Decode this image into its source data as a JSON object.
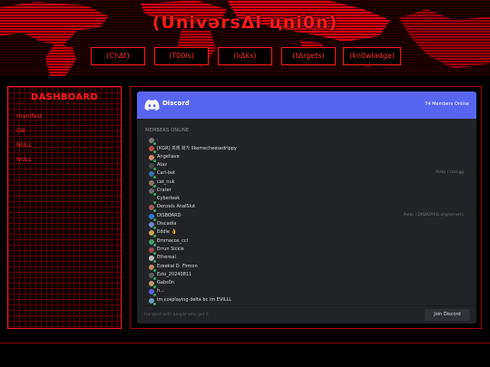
{
  "site": {
    "title": "(UnivǝrsΔl цni0n)"
  },
  "nav": [
    {
      "label": "(ChΔt)"
    },
    {
      "label": "(T00ls)"
    },
    {
      "label": "(lıΔks)"
    },
    {
      "label": "(tΔrgets)"
    },
    {
      "label": "(kn0wlədge)"
    }
  ],
  "sidebar": {
    "heading": "DASHBOARD",
    "items": [
      {
        "label": "manifest"
      },
      {
        "label": "DB"
      },
      {
        "label": "NULL"
      },
      {
        "label": "NULL"
      }
    ]
  },
  "discord": {
    "brand": "Discord",
    "online": "74 Members Online",
    "section": "MEMBERS ONLINE",
    "footer_text": "Hangout with people who get it",
    "join_label": "Join Discord",
    "members": [
      {
        "name": ".",
        "game": "",
        "avatar_color": "#7a7a7a"
      },
      {
        "name": "[KGR] 피래 화가 likemecheesedrippy",
        "game": "",
        "avatar_color": "#b84a4a"
      },
      {
        "name": "Angeliave",
        "game": "",
        "avatar_color": "#d68a6e"
      },
      {
        "name": "Ataz",
        "game": "",
        "avatar_color": "#4a4a4a"
      },
      {
        "name": "Carl-bot",
        "game": "/help | carl.gg",
        "avatar_color": "#3a6ea5"
      },
      {
        "name": "cat_nuk",
        "game": "",
        "avatar_color": "#8d7b64"
      },
      {
        "name": "Crater",
        "game": "",
        "avatar_color": "#6b6b6b"
      },
      {
        "name": "Cyberleek",
        "game": "",
        "avatar_color": "#2b2b2b"
      },
      {
        "name": "Denzels AnalSlut",
        "game": "",
        "avatar_color": "#a35e5e"
      },
      {
        "name": "DISBOARD",
        "game": "/help | DISBOARD.org/servers",
        "avatar_color": "#2e7bd6"
      },
      {
        "name": "Discadia",
        "game": "",
        "avatar_color": "#7289da"
      },
      {
        "name": "Eddie 👌",
        "game": "",
        "avatar_color": "#c9a45c"
      },
      {
        "name": "Emmacox_ccl",
        "game": "",
        "avatar_color": "#4a9b6a"
      },
      {
        "name": "Errun Sickle",
        "game": "",
        "avatar_color": "#9b4a4a"
      },
      {
        "name": "Ethereal",
        "game": "",
        "avatar_color": "#bfbfbf"
      },
      {
        "name": "Ezeekal D. Firmon",
        "game": "",
        "avatar_color": "#c08a6a"
      },
      {
        "name": "Ezio_20240811",
        "game": "",
        "avatar_color": "#5a5a5a"
      },
      {
        "name": "Gabs0n",
        "game": "",
        "avatar_color": "#b89a6a"
      },
      {
        "name": "h...",
        "game": "",
        "avatar_color": "#5865f2"
      },
      {
        "name": "im cosplaying delta bc im EVILLL",
        "game": "",
        "avatar_color": "#6aa0c8"
      }
    ]
  },
  "colors": {
    "accent": "#ff1a1a",
    "discord_blurple": "#5865f2",
    "online_green": "#3ba55d"
  }
}
